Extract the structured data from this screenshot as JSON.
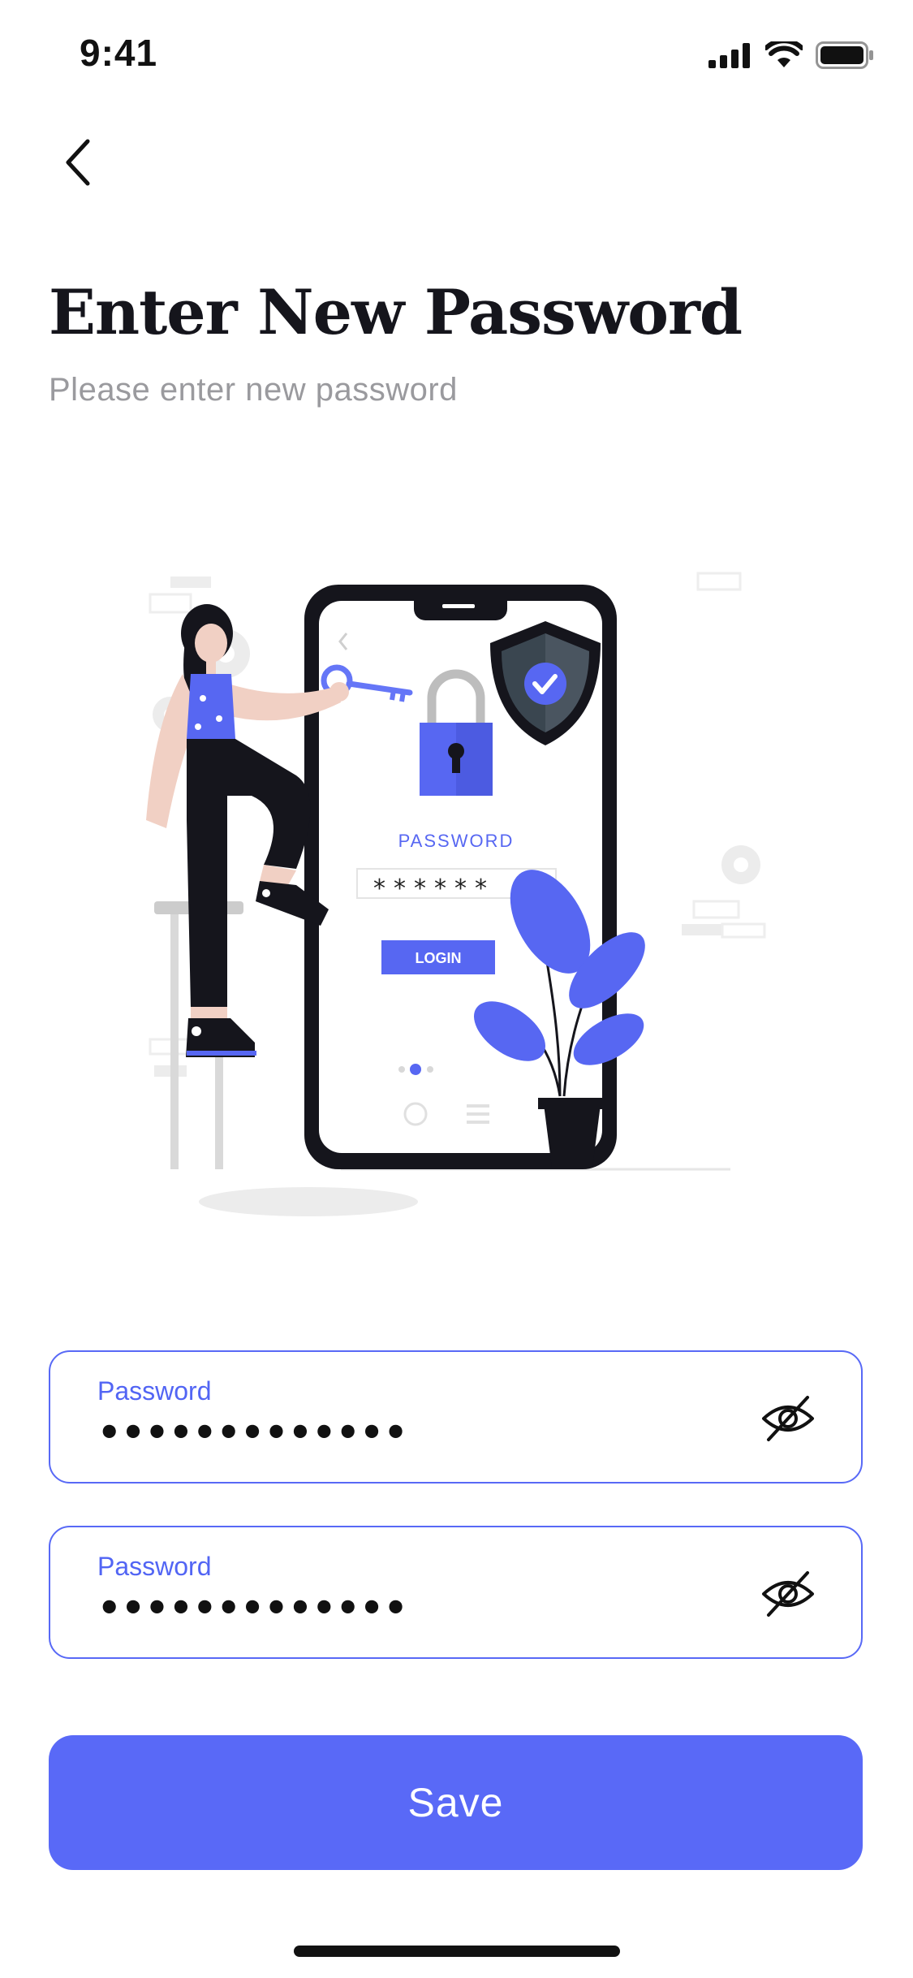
{
  "status_bar": {
    "time": "9:41",
    "icons": [
      "signal-icon",
      "wifi-icon",
      "battery-icon"
    ]
  },
  "header": {
    "back_icon": "chevron-left-icon",
    "title": "Enter New Password",
    "subtitle": "Please enter new password"
  },
  "illustration": {
    "screen_label": "PASSWORD",
    "masked_text": "******",
    "login_button": "LOGIN"
  },
  "form": {
    "fields": [
      {
        "label": "Password",
        "value": "•••••••••••••",
        "icon": "eye-off-icon"
      },
      {
        "label": "Password",
        "value": "•••••••••••••",
        "icon": "eye-off-icon"
      }
    ],
    "save_label": "Save"
  },
  "colors": {
    "accent": "#5969f7",
    "title": "#15151c",
    "subtitle": "#9a9a9e",
    "field_border": "#5869f6"
  }
}
